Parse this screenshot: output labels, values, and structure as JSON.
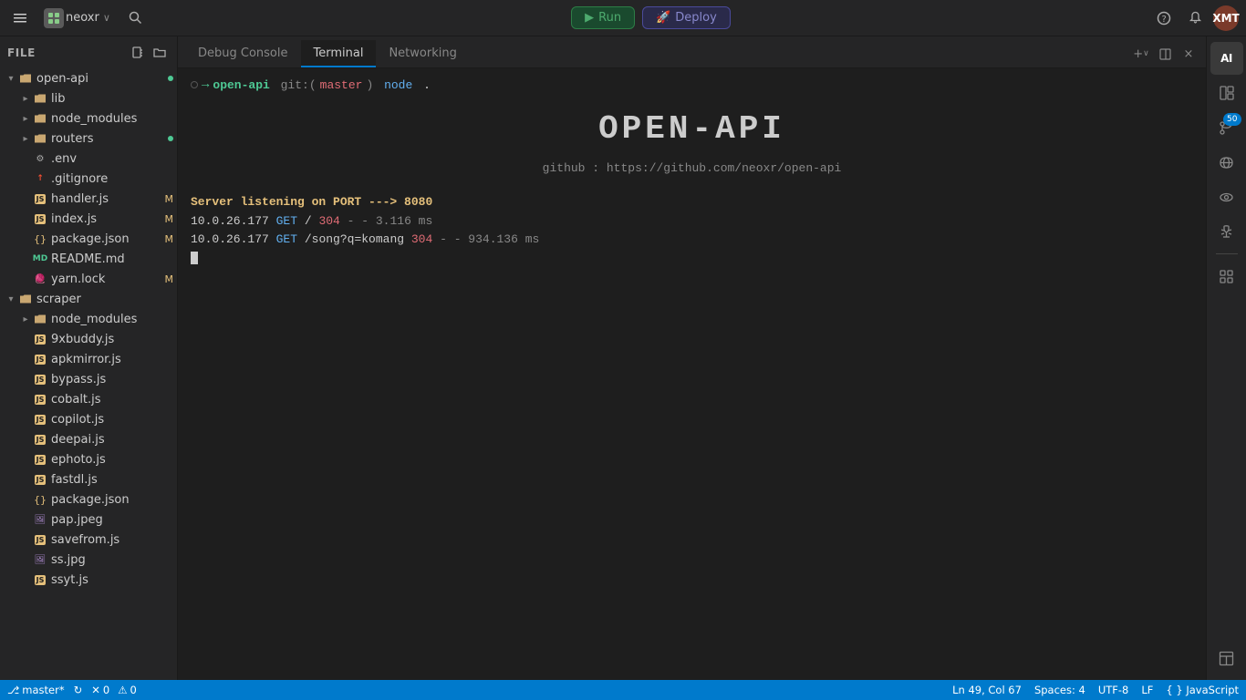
{
  "topbar": {
    "sidebar_toggle_icon": "☰",
    "logo_icon": "◈",
    "app_name": "neoxr",
    "app_chevron": "∨",
    "search_icon": "⌕",
    "workspace_name": "neoxr",
    "run_label": "Run",
    "deploy_label": "Deploy",
    "help_icon": "?",
    "notification_icon": "🔔",
    "avatar_initials": "XMT"
  },
  "sidebar": {
    "title": "File",
    "new_file_icon": "📄",
    "new_folder_icon": "📁",
    "tree": [
      {
        "id": "open-api",
        "indent": 0,
        "type": "folder",
        "expanded": true,
        "label": "open-api",
        "dot": "green"
      },
      {
        "id": "lib",
        "indent": 1,
        "type": "folder",
        "expanded": false,
        "label": "lib",
        "dot": "none"
      },
      {
        "id": "node_modules_1",
        "indent": 1,
        "type": "folder",
        "expanded": false,
        "label": "node_modules",
        "dot": "none"
      },
      {
        "id": "routers",
        "indent": 1,
        "type": "folder",
        "expanded": false,
        "label": "routers",
        "dot": "green"
      },
      {
        "id": "env",
        "indent": 1,
        "type": "file-env",
        "label": ".env",
        "dot": "none"
      },
      {
        "id": "gitignore",
        "indent": 1,
        "type": "file-git",
        "label": ".gitignore",
        "dot": "none"
      },
      {
        "id": "handler",
        "indent": 1,
        "type": "file-js",
        "label": "handler.js",
        "badge": "M"
      },
      {
        "id": "index",
        "indent": 1,
        "type": "file-js",
        "label": "index.js",
        "badge": "M"
      },
      {
        "id": "package_json_1",
        "indent": 1,
        "type": "file-json",
        "label": "package.json",
        "badge": "M"
      },
      {
        "id": "readme",
        "indent": 1,
        "type": "file-readme",
        "label": "README.md",
        "dot": "none"
      },
      {
        "id": "yarn",
        "indent": 1,
        "type": "file-yarn",
        "label": "yarn.lock",
        "badge": "M"
      },
      {
        "id": "scraper",
        "indent": 0,
        "type": "folder",
        "expanded": true,
        "label": "scraper",
        "dot": "none"
      },
      {
        "id": "node_modules_2",
        "indent": 1,
        "type": "folder",
        "expanded": false,
        "label": "node_modules",
        "dot": "none"
      },
      {
        "id": "xbuddy",
        "indent": 1,
        "type": "file-js",
        "label": "9xbuddy.js",
        "dot": "none"
      },
      {
        "id": "apkmirror",
        "indent": 1,
        "type": "file-js",
        "label": "apkmirror.js",
        "dot": "none"
      },
      {
        "id": "bypass",
        "indent": 1,
        "type": "file-js",
        "label": "bypass.js",
        "dot": "none"
      },
      {
        "id": "cobalt",
        "indent": 1,
        "type": "file-js",
        "label": "cobalt.js",
        "dot": "none"
      },
      {
        "id": "copilot",
        "indent": 1,
        "type": "file-js",
        "label": "copilot.js",
        "dot": "none"
      },
      {
        "id": "deepai",
        "indent": 1,
        "type": "file-js",
        "label": "deepai.js",
        "dot": "none"
      },
      {
        "id": "ephoto",
        "indent": 1,
        "type": "file-js",
        "label": "ephoto.js",
        "dot": "none"
      },
      {
        "id": "fastdl",
        "indent": 1,
        "type": "file-js",
        "label": "fastdl.js",
        "dot": "none"
      },
      {
        "id": "package_json_2",
        "indent": 1,
        "type": "file-json",
        "label": "package.json",
        "dot": "none"
      },
      {
        "id": "pap_jpeg",
        "indent": 1,
        "type": "file-img",
        "label": "pap.jpeg",
        "dot": "none"
      },
      {
        "id": "savefrom",
        "indent": 1,
        "type": "file-js",
        "label": "savefrom.js",
        "dot": "none"
      },
      {
        "id": "ss_jpg",
        "indent": 1,
        "type": "file-img",
        "label": "ss.jpg",
        "dot": "none"
      },
      {
        "id": "ssyt",
        "indent": 1,
        "type": "file-js",
        "label": "ssyt.js",
        "dot": "none"
      }
    ]
  },
  "terminal": {
    "tabs": [
      {
        "id": "debug",
        "label": "Debug Console",
        "active": false
      },
      {
        "id": "terminal",
        "label": "Terminal",
        "active": true
      },
      {
        "id": "networking",
        "label": "Networking",
        "active": false
      }
    ],
    "add_icon": "+",
    "split_icon": "⊞",
    "close_icon": "×",
    "prompt": {
      "dir": "open-api",
      "git_prefix": "git:",
      "branch": "master",
      "command": "node",
      "arg": "."
    },
    "banner": "OPEN-API",
    "github_label": "github : https://github.com/neoxr/open-api",
    "server_message": "Server listening on PORT ---> 8080",
    "log_lines": [
      "10.0.26.177 GET / 304 - - 3.116 ms",
      "10.0.26.177 GET /song?q=komang 304 - - 934.136 ms"
    ]
  },
  "right_toolbar": {
    "ai_label": "AI",
    "file_icon": "📄",
    "git_icon": "⑂",
    "git_badge": "50",
    "remote_icon": "⚡",
    "preview_icon": "👁",
    "debug_icon": "🐛",
    "divider": true,
    "grid_icon": "⊞",
    "layout_icon": "⬒"
  },
  "status_bar": {
    "branch_icon": "⎇",
    "branch": "master*",
    "sync_icon": "↻",
    "error_count": "0",
    "error_icon": "✕",
    "warning_count": "0",
    "warning_icon": "⚠",
    "position": "Ln 49, Col 67",
    "spaces": "Spaces: 4",
    "encoding": "UTF-8",
    "line_ending": "LF",
    "language": "{ } JavaScript"
  }
}
